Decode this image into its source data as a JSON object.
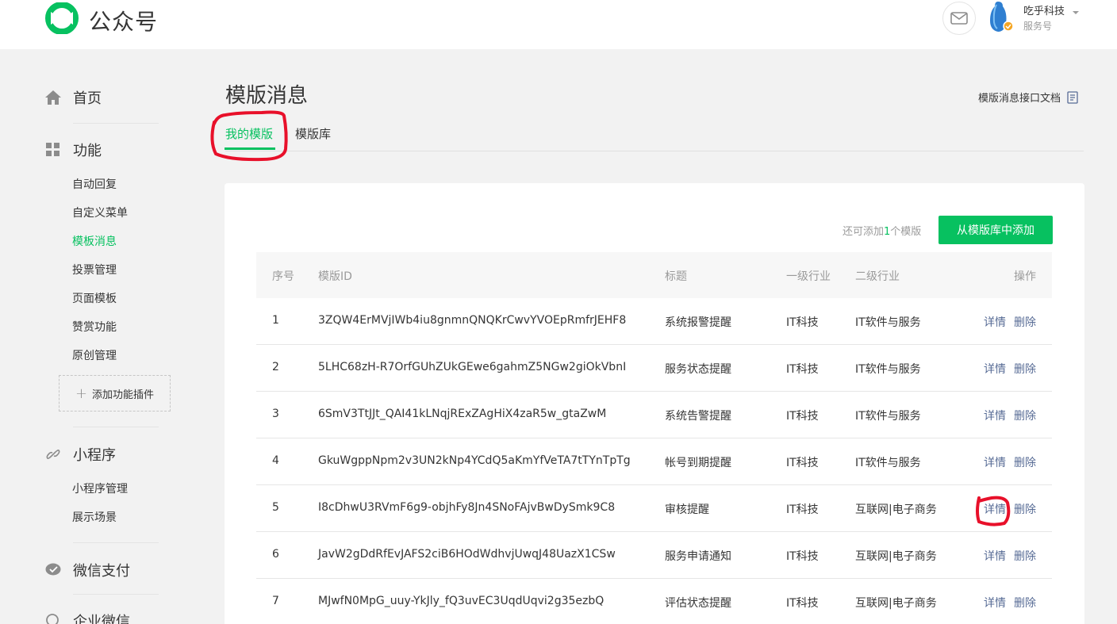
{
  "header": {
    "app_name": "公众号",
    "account_name": "吃乎科技",
    "account_type": "服务号"
  },
  "sidebar": {
    "home": "首页",
    "features": "功能",
    "feature_items": [
      "自动回复",
      "自定义菜单",
      "模板消息",
      "投票管理",
      "页面模板",
      "赞赏功能",
      "原创管理"
    ],
    "active_item": "模板消息",
    "add_plugin": "添加功能插件",
    "miniprogram": "小程序",
    "miniprogram_items": [
      "小程序管理",
      "展示场景"
    ],
    "wechat_pay": "微信支付",
    "wecom": "企业微信"
  },
  "main": {
    "title": "模版消息",
    "doc_link": "模版消息接口文档",
    "tabs": [
      "我的模版",
      "模版库"
    ],
    "active_tab": "我的模版",
    "quota_prefix": "还可添加",
    "quota_count": "1",
    "quota_suffix": "个模版",
    "add_button": "从模版库中添加"
  },
  "table": {
    "columns": [
      "序号",
      "模版ID",
      "标题",
      "一级行业",
      "二级行业",
      "操作"
    ],
    "actions": [
      "详情",
      "删除"
    ],
    "rows": [
      {
        "no": "1",
        "id": "3ZQW4ErMVjIWb4iu8gnmnQNQKrCwvYVOEpRmfrJEHF8",
        "title": "系统报警提醒",
        "industry1": "IT科技",
        "industry2": "IT软件与服务"
      },
      {
        "no": "2",
        "id": "5LHC68zH-R7OrfGUhZUkGEwe6gahmZ5NGw2giOkVbnI",
        "title": "服务状态提醒",
        "industry1": "IT科技",
        "industry2": "IT软件与服务"
      },
      {
        "no": "3",
        "id": "6SmV3TtJJt_QAI41kLNqjRExZAgHiX4zaR5w_gtaZwM",
        "title": "系统告警提醒",
        "industry1": "IT科技",
        "industry2": "IT软件与服务"
      },
      {
        "no": "4",
        "id": "GkuWgppNpm2v3UN2kNp4YCdQ5aKmYfVeTA7tTYnTpTg",
        "title": "帐号到期提醒",
        "industry1": "IT科技",
        "industry2": "IT软件与服务"
      },
      {
        "no": "5",
        "id": "I8cDhwU3RVmF6g9-objhFy8Jn4SNoFAjvBwDySmk9C8",
        "title": "审核提醒",
        "industry1": "IT科技",
        "industry2": "互联网|电子商务"
      },
      {
        "no": "6",
        "id": "JavW2gDdRfEvJAFS2ciB6HOdWdhvjUwqJ48UazX1CSw",
        "title": "服务申请通知",
        "industry1": "IT科技",
        "industry2": "互联网|电子商务"
      },
      {
        "no": "7",
        "id": "MJwfN0MpG_uuy-YkJly_fQ3uvEC3UqdUqvi2g35ezbQ",
        "title": "评估状态提醒",
        "industry1": "IT科技",
        "industry2": "互联网|电子商务"
      }
    ]
  },
  "colors": {
    "brand_green": "#07c160",
    "link_blue": "#576b95",
    "annotation_red": "#e8102a"
  },
  "icons": [
    "wechat-official-logo-icon",
    "mail-icon",
    "home-icon",
    "grid-icon",
    "link-icon",
    "wechat-pay-icon",
    "search-icon",
    "document-icon"
  ]
}
